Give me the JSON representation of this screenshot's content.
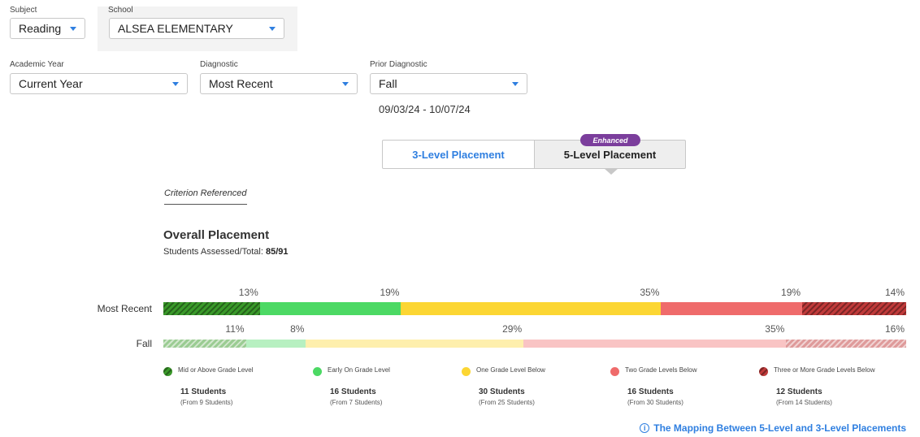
{
  "filters": {
    "subject": {
      "label": "Subject",
      "value": "Reading"
    },
    "school": {
      "label": "School",
      "value": "ALSEA ELEMENTARY"
    },
    "academic_year": {
      "label": "Academic Year",
      "value": "Current Year"
    },
    "diagnostic": {
      "label": "Diagnostic",
      "value": "Most Recent"
    },
    "prior_diagnostic": {
      "label": "Prior Diagnostic",
      "value": "Fall",
      "date_range": "09/03/24 - 10/07/24"
    }
  },
  "toggle": {
    "three_level": "3-Level Placement",
    "five_level": "5-Level Placement",
    "badge": "Enhanced"
  },
  "criterion_tab": "Criterion Referenced",
  "overall": {
    "title": "Overall Placement",
    "assessed_label": "Students Assessed/Total:",
    "assessed_value": "85/91"
  },
  "colors": {
    "mid_or_above": "#3a9a2a",
    "early_on": "#4cd964",
    "one_below": "#fcd633",
    "two_below": "#ef6b6b",
    "three_or_more_below": "#c03a3a"
  },
  "chart_data": {
    "type": "bar",
    "orientation": "horizontal-stacked-100",
    "categories": [
      "Most Recent",
      "Fall"
    ],
    "series": [
      {
        "name": "Mid or Above Grade Level",
        "values": [
          13,
          11
        ]
      },
      {
        "name": "Early On Grade Level",
        "values": [
          19,
          8
        ]
      },
      {
        "name": "One Grade Level Below",
        "values": [
          35,
          29
        ]
      },
      {
        "name": "Two Grade Levels Below",
        "values": [
          19,
          35
        ]
      },
      {
        "name": "Three or More Grade Levels Below",
        "values": [
          14,
          16
        ]
      }
    ],
    "data_labels": {
      "most_recent": [
        "13%",
        "19%",
        "35%",
        "19%",
        "14%"
      ],
      "fall": [
        "11%",
        "8%",
        "29%",
        "35%",
        "16%"
      ]
    }
  },
  "legend": [
    {
      "label": "Mid or Above Grade Level",
      "count": "11 Students",
      "from": "(From 9 Students)",
      "icon": "hatched-dark-green"
    },
    {
      "label": "Early On Grade Level",
      "count": "16 Students",
      "from": "(From 7 Students)",
      "icon": "solid-green"
    },
    {
      "label": "One Grade Level Below",
      "count": "30 Students",
      "from": "(From 25 Students)",
      "icon": "solid-yellow"
    },
    {
      "label": "Two Grade Levels Below",
      "count": "16 Students",
      "from": "(From 30 Students)",
      "icon": "solid-red"
    },
    {
      "label": "Three or More Grade Levels Below",
      "count": "12 Students",
      "from": "(From 14 Students)",
      "icon": "hatched-dark-red"
    }
  ],
  "mapping_link": "The Mapping Between 5-Level and 3-Level Placements"
}
